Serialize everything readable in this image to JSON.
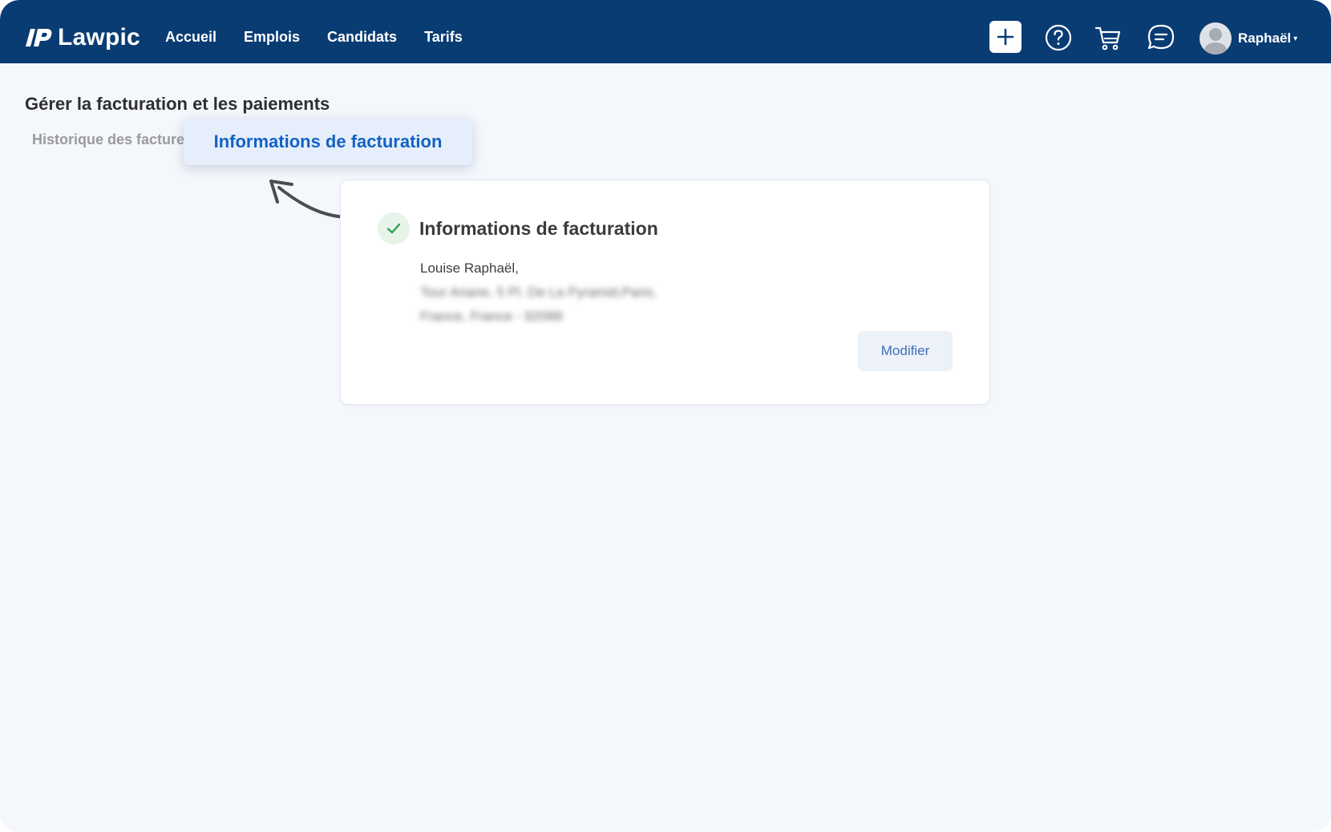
{
  "navbar": {
    "brand": "Lawpic",
    "links": [
      "Accueil",
      "Emplois",
      "Candidats",
      "Tarifs"
    ],
    "icons": [
      "plus-icon",
      "help-icon",
      "cart-icon",
      "chat-icon"
    ],
    "user": {
      "name": "Raphaël",
      "caret": "▾"
    }
  },
  "page": {
    "title": "Gérer la facturation et les paiements",
    "tabs": {
      "history": "Historique des factures",
      "billing_info": "Informations de facturation"
    }
  },
  "card": {
    "title": "Informations de facturation",
    "name_line": "Louise Raphaël,",
    "address_line1": "Tour Ariane, 5 Pl. De La Pyramid,Paris,",
    "address_line2": "France, France - 92088",
    "modify_button": "Modifier"
  },
  "colors": {
    "navbar": "#0a3c74",
    "background": "#f4f7fc",
    "accent": "#1262c4",
    "active_tab_bg": "#e6eefc",
    "success": "#2e9e4f"
  }
}
